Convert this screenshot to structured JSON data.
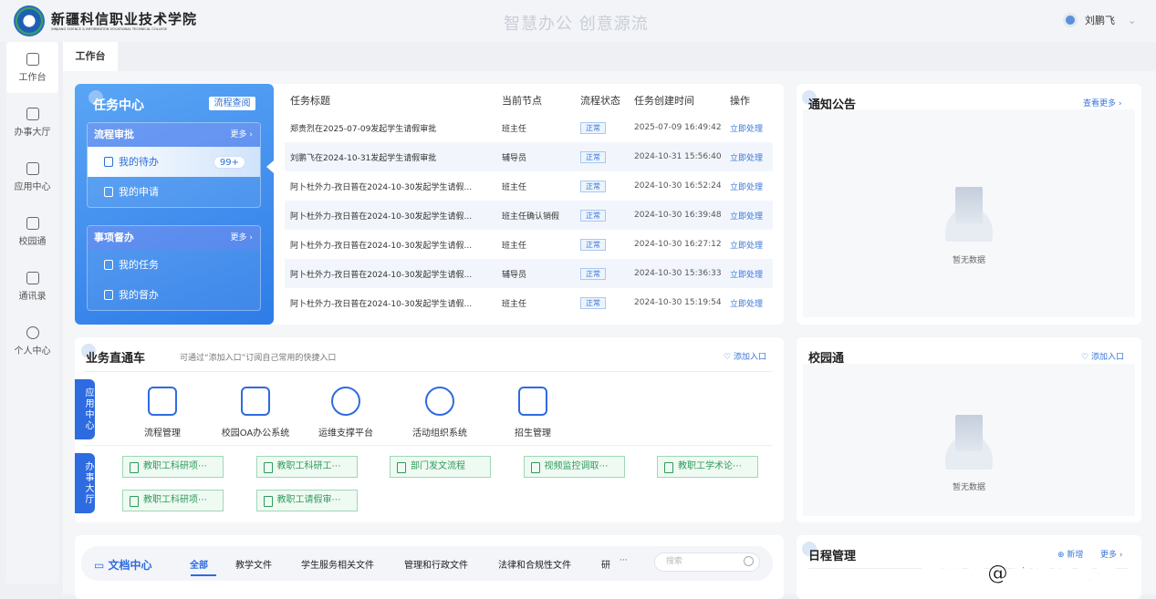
{
  "header": {
    "school_name": "新疆科信职业技术学院",
    "school_en": "XINJIANG SCIENCE & INFORMATION VOCATIONAL TECHNICAL COLLEGE",
    "slogan": "智慧办公 创意源流",
    "user_name": "刘鹏飞"
  },
  "sidebar": {
    "items": [
      {
        "label": "工作台",
        "icon": "home-icon"
      },
      {
        "label": "办事大厅",
        "icon": "heart-icon"
      },
      {
        "label": "应用中心",
        "icon": "grid-icon"
      },
      {
        "label": "校园通",
        "icon": "building-icon"
      },
      {
        "label": "通讯录",
        "icon": "contact-icon"
      },
      {
        "label": "个人中心",
        "icon": "user-icon"
      }
    ]
  },
  "tabs": [
    "工作台"
  ],
  "task_center": {
    "title": "任务中心",
    "query_button": "流程查阅",
    "groups": [
      {
        "title": "流程审批",
        "more": "更多",
        "items": [
          {
            "label": "我的待办",
            "badge": "99+"
          },
          {
            "label": "我的申请"
          }
        ]
      },
      {
        "title": "事项督办",
        "more": "更多",
        "items": [
          {
            "label": "我的任务"
          },
          {
            "label": "我的督办"
          }
        ]
      }
    ],
    "columns": [
      "任务标题",
      "当前节点",
      "流程状态",
      "任务创建时间",
      "操作"
    ],
    "rows": [
      [
        "郑贵烈在2025-07-09发起学生请假审批",
        "班主任",
        "正常",
        "2025-07-09 16:49:42",
        "立即处理"
      ],
      [
        "刘鹏飞在2024-10-31发起学生请假审批",
        "辅导员",
        "正常",
        "2024-10-31 15:56:40",
        "立即处理"
      ],
      [
        "阿卜杜外力-孜日普在2024-10-30发起学生请假...",
        "班主任",
        "正常",
        "2024-10-30 16:52:24",
        "立即处理"
      ],
      [
        "阿卜杜外力-孜日普在2024-10-30发起学生请假...",
        "班主任确认销假",
        "正常",
        "2024-10-30 16:39:48",
        "立即处理"
      ],
      [
        "阿卜杜外力-孜日普在2024-10-30发起学生请假...",
        "班主任",
        "正常",
        "2024-10-30 16:27:12",
        "立即处理"
      ],
      [
        "阿卜杜外力-孜日普在2024-10-30发起学生请假...",
        "辅导员",
        "正常",
        "2024-10-30 15:36:33",
        "立即处理"
      ],
      [
        "阿卜杜外力-孜日普在2024-10-30发起学生请假...",
        "班主任",
        "正常",
        "2024-10-30 15:19:54",
        "立即处理"
      ]
    ]
  },
  "notice": {
    "title": "通知公告",
    "more": "查看更多",
    "empty": "暂无数据"
  },
  "business": {
    "title": "业务直通车",
    "subtitle": "可通过“添加入口”订阅自己常用的快捷入口",
    "add": "添加入口",
    "app_label": "应用中心",
    "hall_label": "办事大厅",
    "apps": [
      "流程管理",
      "校园OA办公系统",
      "运维支撑平台",
      "活动组织系统",
      "招生管理"
    ],
    "quick": [
      "教职工科研项⋯",
      "教职工科研工⋯",
      "部门发文流程",
      "视频监控调取⋯",
      "教职工学术论⋯",
      "教职工科研项⋯",
      "教职工请假审⋯"
    ]
  },
  "campus": {
    "title": "校园通",
    "add": "添加入口",
    "empty": "暂无数据"
  },
  "docs": {
    "title": "文档中心",
    "tabs": [
      "全部",
      "教学文件",
      "学生服务相关文件",
      "管理和行政文件",
      "法律和合规性文件",
      "研"
    ],
    "overflow": "···",
    "search_placeholder": "搜索"
  },
  "schedule": {
    "title": "日程管理",
    "add": "新增",
    "more": "更多"
  },
  "watermark": "搜狐号@通信信息报",
  "colors": {
    "primary": "#2e6be0",
    "link": "#3a78d8",
    "quick_green": "#2f9b5a"
  }
}
